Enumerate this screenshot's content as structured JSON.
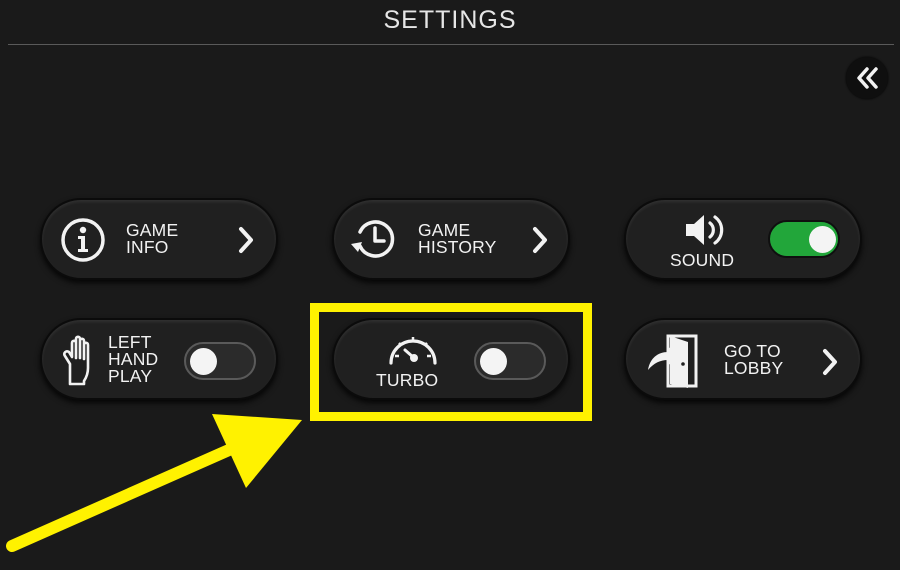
{
  "header": {
    "title": "SETTINGS"
  },
  "collapse": {
    "icon": "double-chevron-left-icon"
  },
  "tiles": {
    "game_info": {
      "label": "GAME\nINFO",
      "icon": "info-icon",
      "action_icon": "chevron-right-icon"
    },
    "game_history": {
      "label": "GAME\nHISTORY",
      "icon": "history-clock-icon",
      "action_icon": "chevron-right-icon"
    },
    "sound": {
      "label": "SOUND",
      "icon": "speaker-icon",
      "toggle": "on"
    },
    "left_hand_play": {
      "label": "LEFT\nHAND\nPLAY",
      "icon": "hand-icon",
      "toggle": "off"
    },
    "turbo": {
      "label": "TURBO",
      "icon": "speedometer-icon",
      "toggle": "off"
    },
    "go_to_lobby": {
      "label": "GO TO\nLOBBY",
      "icon": "exit-door-icon",
      "action_icon": "chevron-right-icon"
    }
  },
  "annotation": {
    "highlight_color": "#fff200",
    "highlight_target": "turbo"
  },
  "colors": {
    "background": "#1a1a1a",
    "toggle_on": "#22a63a",
    "toggle_off": "#2b2b2b",
    "text": "#f2f2f2"
  }
}
